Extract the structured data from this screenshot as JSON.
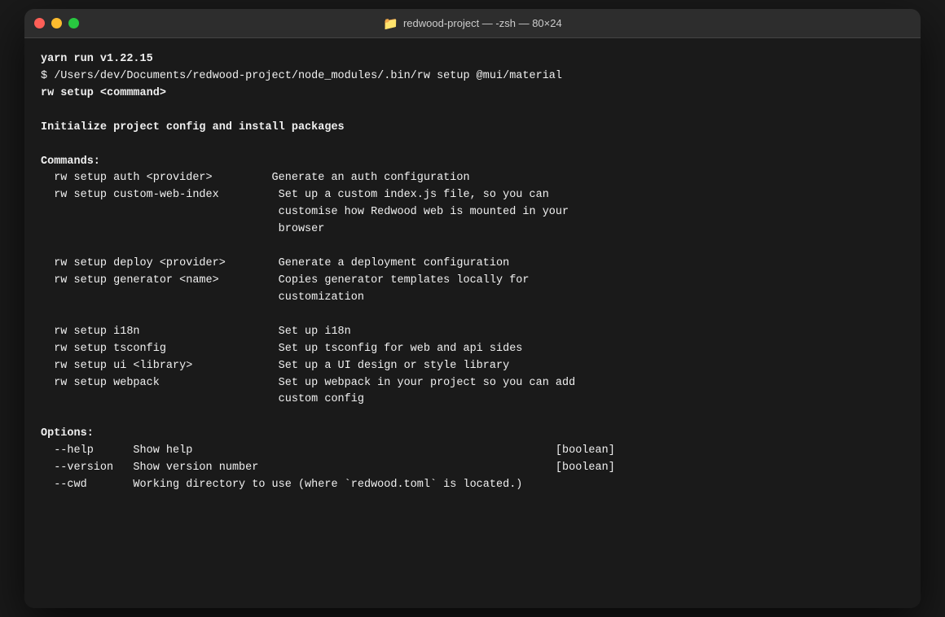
{
  "window": {
    "title": "redwood-project — -zsh — 80×24"
  },
  "terminal": {
    "yarn_version_line": "yarn run v1.22.15",
    "prompt_line": "$ /Users/dev/Documents/redwood-project/node_modules/.bin/rw setup @mui/material",
    "rw_command": "rw setup <commmand>",
    "blank1": "",
    "init_line": "Initialize project config and install packages",
    "blank2": "",
    "commands_header": "Commands:",
    "commands": [
      {
        "cmd": "  rw setup auth <provider>",
        "desc": "Generate an auth configuration"
      },
      {
        "cmd": "  rw setup custom-web-index",
        "desc": "Set up a custom index.js file, so you can",
        "desc2": "                                          customise how Redwood web is mounted in your",
        "desc3": "                                          browser"
      },
      {
        "cmd": "  rw setup deploy <provider>",
        "desc": "Generate a deployment configuration"
      },
      {
        "cmd": "  rw setup generator <name>",
        "desc": "Copies generator templates locally for",
        "desc2": "                                          customization"
      },
      {
        "cmd": "  rw setup i18n",
        "desc": "Set up i18n"
      },
      {
        "cmd": "  rw setup tsconfig",
        "desc": "Set up tsconfig for web and api sides"
      },
      {
        "cmd": "  rw setup ui <library>",
        "desc": "Set up a UI design or style library"
      },
      {
        "cmd": "  rw setup webpack",
        "desc": "Set up webpack in your project so you can add",
        "desc2": "                                          custom config"
      }
    ],
    "blank3": "",
    "options_header": "Options:",
    "options": [
      {
        "flag": "  --help",
        "desc": "    Show help",
        "type": "[boolean]"
      },
      {
        "flag": "  --version",
        "desc": " Show version number",
        "type": "[boolean]"
      },
      {
        "flag": "  --cwd",
        "desc": "      Working directory to use (where `redwood.toml` is located.)",
        "type": ""
      }
    ]
  }
}
